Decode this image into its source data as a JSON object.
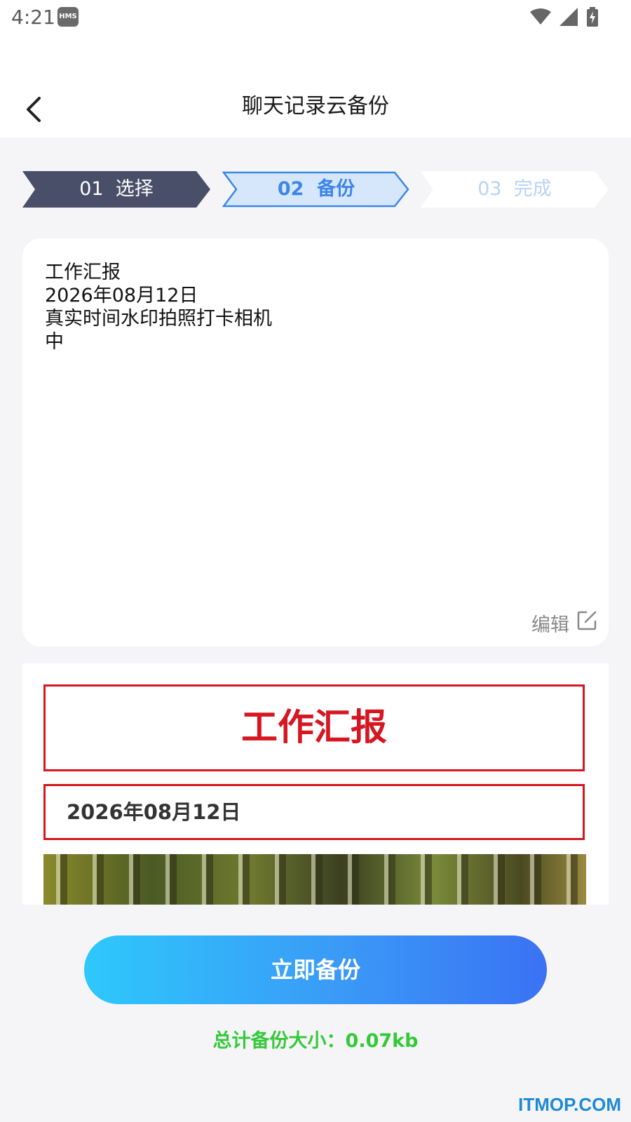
{
  "status_bar": {
    "time": "4:21",
    "badge": "HMS",
    "icons": [
      "wifi-icon",
      "signal-icon",
      "battery-charging-icon"
    ]
  },
  "header": {
    "back_icon": "chevron-left-icon",
    "title": "聊天记录云备份"
  },
  "steps": [
    {
      "label": "01  选择",
      "state": "done"
    },
    {
      "label": "02  备份",
      "state": "active"
    },
    {
      "label": "03  完成",
      "state": "pending"
    }
  ],
  "note": {
    "lines": [
      "工作汇报",
      "2026年08月12日",
      "真实时间水印拍照打卡相机",
      "中"
    ],
    "edit_label": "编辑",
    "edit_icon": "edit-icon"
  },
  "preview": {
    "title": "工作汇报",
    "date": "2026年08月12日"
  },
  "backup_button": "立即备份",
  "total_size": "总计备份大小：0.07kb",
  "watermark": "ITMOP.COM",
  "colors": {
    "step_done": "#4a4f69",
    "step_active_fill": "#d6e7fc",
    "step_active_stroke": "#3d86ea",
    "accent_red": "#d61620",
    "accent_green": "#35c93a"
  }
}
